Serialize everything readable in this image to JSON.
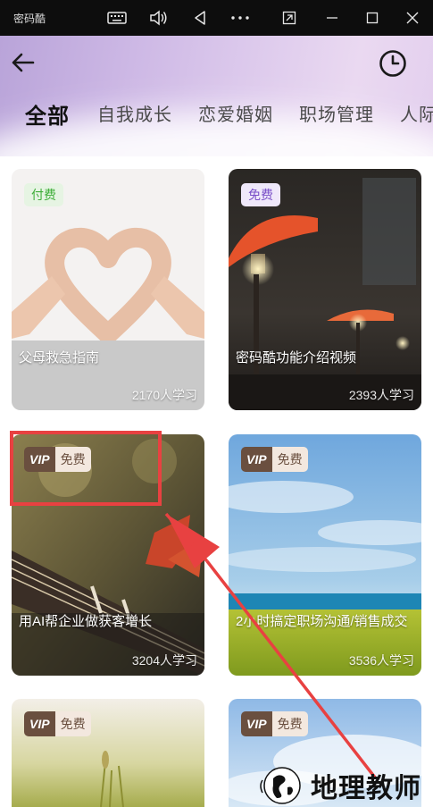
{
  "window": {
    "app_name": "密码酷"
  },
  "header": {
    "tabs": [
      "全部",
      "自我成长",
      "恋爱婚姻",
      "职场管理",
      "人际"
    ]
  },
  "cards": [
    {
      "badge": "付费",
      "title": "父母救急指南",
      "count": "2170人学习"
    },
    {
      "badge": "免费",
      "title": "密码酷功能介绍视频",
      "count": "2393人学习"
    },
    {
      "vip": "VIP",
      "badge": "免费",
      "title": "用AI帮企业做获客增长",
      "count": "3204人学习"
    },
    {
      "vip": "VIP",
      "badge": "免费",
      "title": "2小时搞定职场沟通/销售成交",
      "count": "3536人学习"
    },
    {
      "vip": "VIP",
      "badge": "免费"
    },
    {
      "vip": "VIP",
      "badge": "免费"
    }
  ],
  "watermark": {
    "text": "地理教师"
  },
  "colors": {
    "accent": "#7a4fc8",
    "paid": "#3fae3a",
    "highlight": "#e84141"
  }
}
